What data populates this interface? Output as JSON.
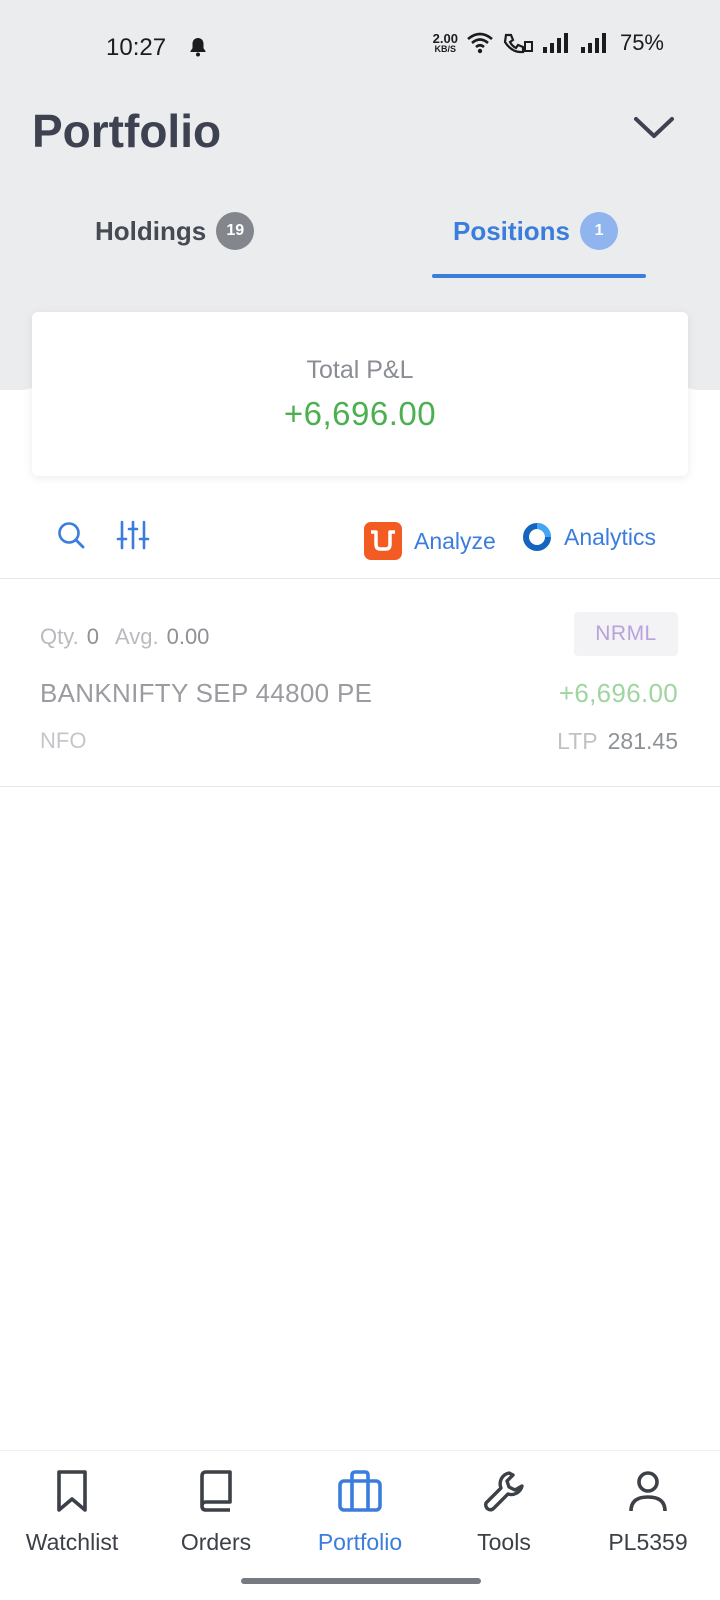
{
  "status_bar": {
    "time": "10:27",
    "net_speed_value": "2.00",
    "net_speed_unit": "KB/S",
    "battery": "75%",
    "icons": [
      "bell-icon",
      "wifi-icon",
      "wifi-call-icon",
      "signal-icon",
      "signal-icon"
    ]
  },
  "header": {
    "title": "Portfolio"
  },
  "tabs": [
    {
      "label": "Holdings",
      "count": "19",
      "active": false
    },
    {
      "label": "Positions",
      "count": "1",
      "active": true
    }
  ],
  "summary": {
    "label": "Total P&L",
    "value": "+6,696.00"
  },
  "toolbar": {
    "analyze_label": "Analyze",
    "analytics_label": "Analytics"
  },
  "positions": [
    {
      "qty_label": "Qty.",
      "qty": "0",
      "avg_label": "Avg.",
      "avg": "0.00",
      "product": "NRML",
      "instrument": "BANKNIFTY SEP 44800 PE",
      "pnl": "+6,696.00",
      "exchange": "NFO",
      "ltp_label": "LTP",
      "ltp": "281.45"
    }
  ],
  "nav": [
    {
      "label": "Watchlist",
      "icon": "bookmark-icon"
    },
    {
      "label": "Orders",
      "icon": "book-icon"
    },
    {
      "label": "Portfolio",
      "icon": "briefcase-icon",
      "active": true
    },
    {
      "label": "Tools",
      "icon": "wrench-icon"
    },
    {
      "label": "PL5359",
      "icon": "user-icon"
    }
  ],
  "colors": {
    "accent": "#3b7ddd",
    "profit": "#4caf50",
    "header_bg": "#ebecee",
    "analyze_brand": "#f25b22",
    "analytics_brand": "#1565c0"
  }
}
